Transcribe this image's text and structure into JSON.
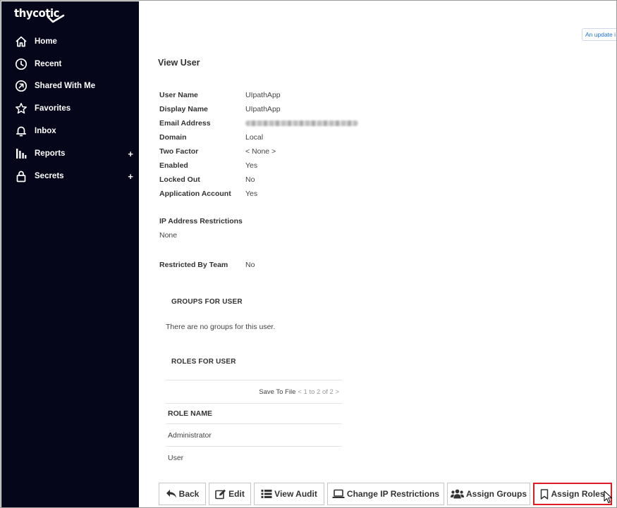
{
  "brand": {
    "name": "thycotic"
  },
  "sidebar": {
    "items": [
      {
        "label": "Home",
        "icon": "home-icon",
        "expandable": false
      },
      {
        "label": "Recent",
        "icon": "clock-icon",
        "expandable": false
      },
      {
        "label": "Shared With Me",
        "icon": "shared-icon",
        "expandable": false
      },
      {
        "label": "Favorites",
        "icon": "star-icon",
        "expandable": false
      },
      {
        "label": "Inbox",
        "icon": "bell-icon",
        "expandable": false
      },
      {
        "label": "Reports",
        "icon": "bar-chart-icon",
        "expandable": true
      },
      {
        "label": "Secrets",
        "icon": "lock-icon",
        "expandable": true
      }
    ],
    "expand_symbol": "+"
  },
  "update_notice": "An update i",
  "page": {
    "title": "View User",
    "fields": [
      {
        "label": "User Name",
        "value": "UIpathApp"
      },
      {
        "label": "Display Name",
        "value": "UIpathApp"
      },
      {
        "label": "Email Address",
        "value": ""
      },
      {
        "label": "Domain",
        "value": "Local"
      },
      {
        "label": "Two Factor",
        "value": "< None >"
      },
      {
        "label": "Enabled",
        "value": "Yes"
      },
      {
        "label": "Locked Out",
        "value": "No"
      },
      {
        "label": "Application Account",
        "value": "Yes"
      }
    ],
    "ip_restrictions": {
      "label": "IP Address Restrictions",
      "value": "None"
    },
    "restricted_by_team": {
      "label": "Restricted By Team",
      "value": "No"
    },
    "groups": {
      "heading": "GROUPS FOR USER",
      "empty_text": "There are no groups for this user."
    },
    "roles": {
      "heading": "ROLES FOR USER",
      "save_to_file": "Save To File",
      "pager": "< 1 to 2 of 2 >",
      "column_header": "ROLE NAME",
      "rows": [
        "Administrator",
        "User"
      ]
    }
  },
  "buttons": {
    "back": "Back",
    "edit": "Edit",
    "view_audit": "View Audit",
    "change_ip": "Change IP Restrictions",
    "assign_groups": "Assign Groups",
    "assign_roles": "Assign Roles"
  },
  "colors": {
    "sidebar_bg": "#06061a",
    "highlight": "#e01b24",
    "link": "#1a73e8"
  }
}
